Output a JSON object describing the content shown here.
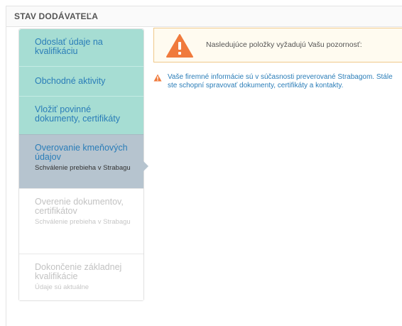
{
  "panel": {
    "title": "STAV DODÁVATEĽA"
  },
  "steps": [
    {
      "title": "Odoslať údaje na kvalifikáciu",
      "subtitle": "",
      "state": "done"
    },
    {
      "title": "Obchodné aktivity",
      "subtitle": "",
      "state": "done"
    },
    {
      "title": "Vložiť povinné dokumenty, certifikáty",
      "subtitle": "",
      "state": "done"
    },
    {
      "title": "Overovanie kmeňových údajov",
      "subtitle": "Schválenie prebieha v Strabagu",
      "state": "current"
    },
    {
      "title": "Overenie dokumentov, certifikátov",
      "subtitle": "Schválenie prebieha v Strabagu",
      "state": "todo"
    },
    {
      "title": "Dokončenie základnej kvalifikácie",
      "subtitle": "Údaje sú aktuálne",
      "state": "todo"
    }
  ],
  "alert": {
    "icon": "warning-icon",
    "text": "Nasledujúce položky vyžadujú Vašu pozornosť:"
  },
  "warnings": [
    {
      "icon": "warning-icon",
      "text": "Vaše firemné informácie sú v súčasnosti preverované Strabagom. Stále ste schopní spravovať dokumenty, certifikáty a kontakty."
    }
  ],
  "colors": {
    "step_done": "#a6ddd3",
    "step_current": "#b6c4cf",
    "link_blue": "#2a7db8",
    "warning_orange": "#f07a3c"
  }
}
